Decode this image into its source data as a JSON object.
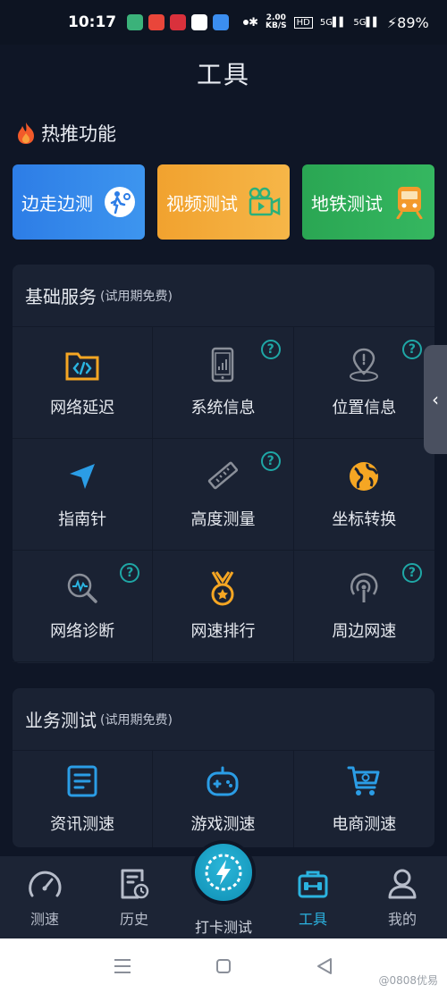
{
  "status_bar": {
    "time": "10:17",
    "net_speed_value": "2.00",
    "net_speed_unit": "KB/S",
    "hd": "HD",
    "sim1": "5G",
    "sim2": "5G",
    "battery": "89%"
  },
  "page_title": "工具",
  "hot": {
    "title": "热推功能",
    "cards": [
      {
        "label": "边走边测",
        "icon": "walking-person-icon",
        "color": "#2d7de6"
      },
      {
        "label": "视频测试",
        "icon": "video-camera-icon",
        "color": "#f1a22f"
      },
      {
        "label": "地铁测试",
        "icon": "subway-train-icon",
        "color": "#2aa653"
      }
    ]
  },
  "basic": {
    "title": "基础服务",
    "subtitle": "(试用期免费)",
    "items": [
      {
        "label": "网络延迟",
        "icon": "code-folder-icon",
        "help": false
      },
      {
        "label": "系统信息",
        "icon": "smartphone-icon",
        "help": true
      },
      {
        "label": "位置信息",
        "icon": "location-pin-icon",
        "help": true
      },
      {
        "label": "指南针",
        "icon": "compass-arrow-icon",
        "help": false
      },
      {
        "label": "高度测量",
        "icon": "ruler-icon",
        "help": true
      },
      {
        "label": "坐标转换",
        "icon": "globe-icon",
        "help": false
      },
      {
        "label": "网络诊断",
        "icon": "search-diagnose-icon",
        "help": true
      },
      {
        "label": "网速排行",
        "icon": "medal-icon",
        "help": false
      },
      {
        "label": "周边网速",
        "icon": "broadcast-icon",
        "help": true
      }
    ]
  },
  "business": {
    "title": "业务测试",
    "subtitle": "(试用期免费)",
    "items": [
      {
        "label": "资讯测速",
        "icon": "news-icon"
      },
      {
        "label": "游戏测速",
        "icon": "gamepad-icon"
      },
      {
        "label": "电商测速",
        "icon": "shopping-cart-icon"
      }
    ]
  },
  "help_glyph": "?",
  "side_handle_glyph": "‹",
  "bottom_nav": {
    "items": [
      {
        "label": "测速",
        "icon": "speedometer-icon"
      },
      {
        "label": "历史",
        "icon": "history-icon"
      },
      {
        "label": "打卡测试",
        "icon": "checkin-speed-icon"
      },
      {
        "label": "工具",
        "icon": "toolbox-icon",
        "active": true
      },
      {
        "label": "我的",
        "icon": "user-icon"
      }
    ]
  },
  "watermark": "@0808优易",
  "colors": {
    "accent": "#2bb3e0",
    "help": "#1fa7a6",
    "background": "#0f1626",
    "card": "#1a2233"
  }
}
